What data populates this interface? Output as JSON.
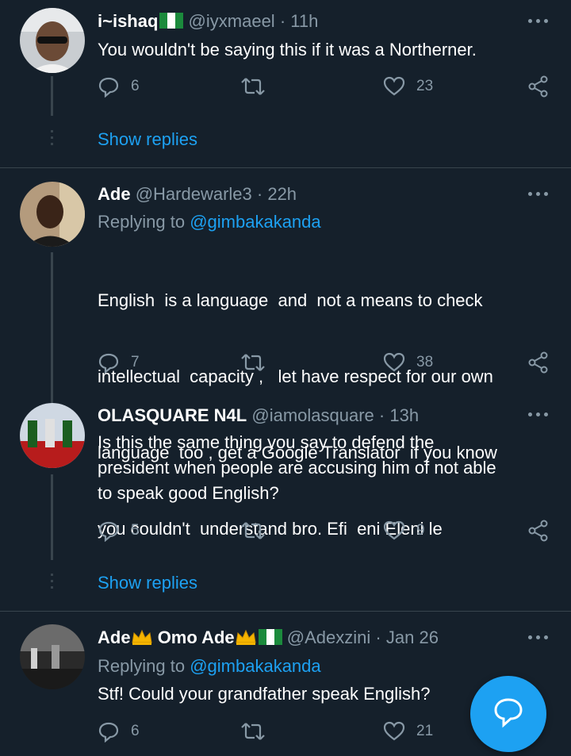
{
  "tweets": [
    {
      "name": "i~ishaq",
      "handle": "@iyxmaeel",
      "time": "11h",
      "replying_label": "",
      "replying_to": "",
      "body": "You wouldn't be saying this if it was a Northerner.",
      "replies": "6",
      "retweets": "",
      "likes": "23",
      "show_replies": "Show replies"
    },
    {
      "name": "Ade",
      "handle": "@Hardewarle3",
      "time": "22h",
      "replying_label": "Replying to",
      "replying_to": "@gimbakakanda",
      "body_lines": [
        "English  is a language  and  not a means to check",
        "intellectual  capacity ,   let have respect for our own",
        "language  too , get a Google Translator  if you know",
        "you couldn't  understand bro. Efi  eni Eleni le"
      ],
      "replies": "7",
      "retweets": "",
      "likes": "38"
    },
    {
      "name": "OLASQUARE N4L",
      "handle": "@iamolasquare",
      "time": "13h",
      "body_lines": [
        "Is this the same thing you say to defend the",
        "president when people are accusing him of not able",
        "to speak good English?"
      ],
      "replies": "5",
      "retweets": "",
      "likes": "9",
      "show_replies": "Show replies"
    },
    {
      "name_part1": "Ade",
      "name_part2": "Omo Ade",
      "handle": "@Adexzini",
      "time": "Jan 26",
      "replying_label": "Replying to",
      "replying_to": "@gimbakakanda",
      "body": "Stf! Could your grandfather speak English?",
      "replies": "6",
      "likes": "21"
    }
  ],
  "separator": "·",
  "colors": {
    "background": "#15202b",
    "text_primary": "#ffffff",
    "text_secondary": "#8899a6",
    "accent": "#1da1f2",
    "divider": "#38444d"
  },
  "icons": [
    "reply-icon",
    "retweet-icon",
    "like-icon",
    "share-icon",
    "more-icon",
    "nigeria-flag-icon",
    "crown-icon",
    "compose-icon"
  ]
}
